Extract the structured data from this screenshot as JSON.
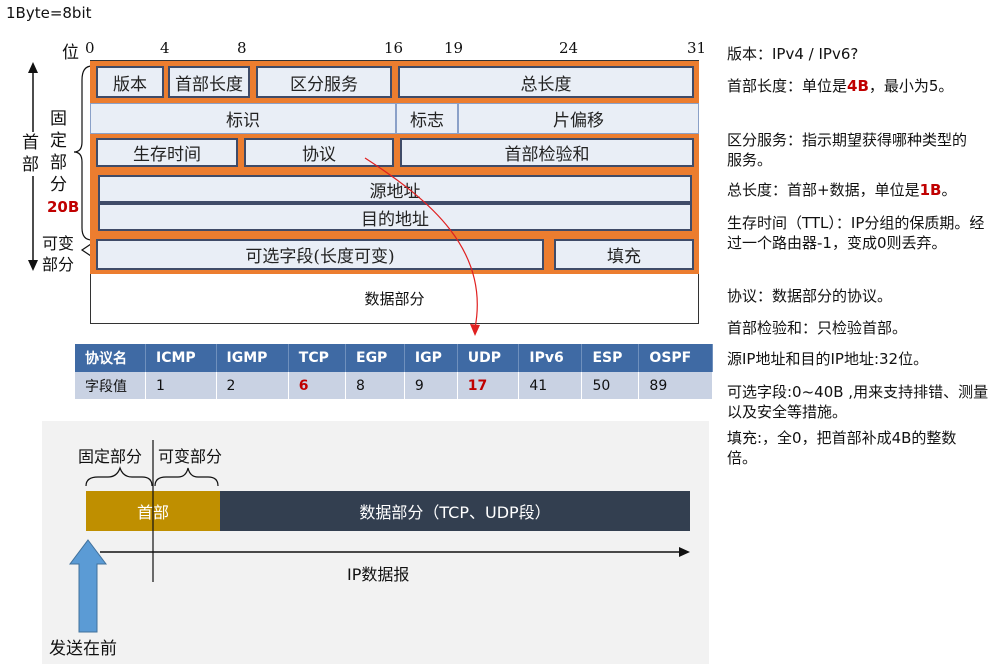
{
  "top_label": "1Byte=8bit",
  "bit_label": "位",
  "bit_ticks": [
    "0",
    "4",
    "8",
    "16",
    "19",
    "24",
    "31"
  ],
  "side": {
    "header": "首\n部",
    "fixed": "固\n定\n部\n分",
    "fixed_size": "20B",
    "variable": "可变\n部分"
  },
  "fields": {
    "version": "版本",
    "header_length": "首部长度",
    "tos": "区分服务",
    "total_length": "总长度",
    "identification": "标识",
    "flags": "标志",
    "fragment_offset": "片偏移",
    "ttl": "生存时间",
    "protocol": "协议",
    "checksum": "首部检验和",
    "src": "源地址",
    "dst": "目的地址",
    "options": "可选字段(长度可变)",
    "padding": "填充",
    "data": "数据部分"
  },
  "protocol_table": {
    "headers": [
      "协议名",
      "ICMP",
      "IGMP",
      "TCP",
      "EGP",
      "IGP",
      "UDP",
      "IPv6",
      "ESP",
      "OSPF"
    ],
    "values": [
      "字段值",
      "1",
      "2",
      "6",
      "8",
      "9",
      "17",
      "41",
      "50",
      "89"
    ],
    "highlight": [
      "6",
      "17"
    ]
  },
  "notes": [
    {
      "parts": [
        {
          "t": "版本：IPv4 / IPv6?"
        }
      ]
    },
    {
      "parts": [
        {
          "t": "首部长度：单位是"
        },
        {
          "t": "4B",
          "red": true
        },
        {
          "t": "，最小为5。"
        }
      ]
    },
    {
      "parts": [
        {
          "t": "区分服务：指示期望获得哪种类型的服务。"
        }
      ]
    },
    {
      "parts": [
        {
          "t": "总长度：首部+数据，单位是"
        },
        {
          "t": "1B",
          "red": true
        },
        {
          "t": "。"
        }
      ]
    },
    {
      "parts": [
        {
          "t": "生存时间（TTL）：IP分组的保质期。经过一个路由器-1，变成0则丢弃。"
        }
      ]
    },
    {
      "parts": [
        {
          "t": "协议：数据部分的协议。"
        }
      ]
    },
    {
      "parts": [
        {
          "t": "首部检验和：只检验首部。"
        }
      ]
    },
    {
      "parts": [
        {
          "t": "源IP地址和目的IP地址:32位。"
        }
      ]
    },
    {
      "parts": [
        {
          "t": "可选字段:0~40B ,用来支持排错、测量以及安全等措施。"
        }
      ]
    },
    {
      "parts": [
        {
          "t": "填充:，全0，把首部补成4B的整数倍。"
        }
      ]
    }
  ],
  "bottom": {
    "fixed_label": "固定部分",
    "variable_label": "可变部分",
    "header": "首部",
    "data": "数据部分（TCP、UDP段）",
    "datagram": "IP数据报",
    "send_first": "发送在前"
  },
  "colors": {
    "orange": "#ec7d2f",
    "cell_fill": "#e9eef6",
    "table_header": "#3f6aa4",
    "table_row": "#c9d2e3",
    "highlight": "#c00000",
    "header_bar": "#bf8f00",
    "data_bar": "#333f50",
    "send_arrow": "#5b9bd5"
  }
}
